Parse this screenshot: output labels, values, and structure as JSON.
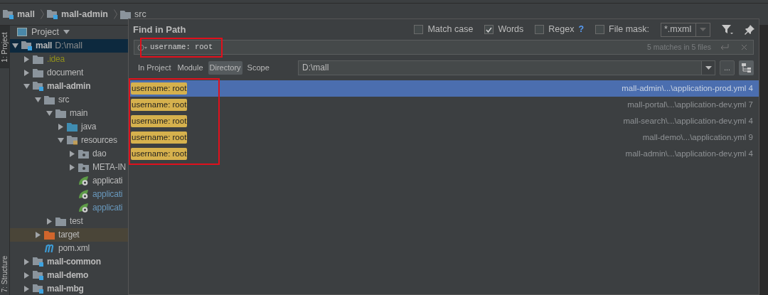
{
  "breadcrumbs": [
    {
      "label": "mall",
      "kind": "module"
    },
    {
      "label": "mall-admin",
      "kind": "module"
    },
    {
      "label": "src",
      "kind": "folder"
    }
  ],
  "tool_stripe": {
    "top": "1: Project",
    "bottom": "7: Structure"
  },
  "project_panel": {
    "title": "Project",
    "tree": [
      {
        "label": "mall",
        "path": "D:\\mall",
        "kind": "module",
        "expanded": true,
        "selected": true,
        "children": [
          {
            "label": ".idea",
            "kind": "folder",
            "expanded": false,
            "selected": false,
            "ignored": true
          },
          {
            "label": "document",
            "kind": "folder",
            "expanded": false,
            "selected": false
          },
          {
            "label": "mall-admin",
            "kind": "module",
            "expanded": true,
            "selected": false,
            "children": [
              {
                "label": "src",
                "kind": "folder",
                "expanded": true,
                "selected": false,
                "children": [
                  {
                    "label": "main",
                    "kind": "folder",
                    "expanded": true,
                    "selected": false,
                    "children": [
                      {
                        "label": "java",
                        "kind": "source",
                        "expanded": false,
                        "selected": false
                      },
                      {
                        "label": "resources",
                        "kind": "resources",
                        "expanded": true,
                        "selected": false,
                        "children": [
                          {
                            "label": "dao",
                            "kind": "package",
                            "expanded": false,
                            "selected": false
                          },
                          {
                            "label": "META-IN",
                            "kind": "package",
                            "expanded": false,
                            "selected": false
                          },
                          {
                            "label": "applicati",
                            "kind": "spring",
                            "selected": false
                          },
                          {
                            "label": "applicati",
                            "kind": "spring",
                            "selected": false,
                            "modified": true
                          },
                          {
                            "label": "applicati",
                            "kind": "spring",
                            "selected": false,
                            "modified": true
                          }
                        ]
                      }
                    ]
                  },
                  {
                    "label": "test",
                    "kind": "folder",
                    "expanded": false,
                    "selected": false
                  }
                ]
              },
              {
                "label": "target",
                "kind": "target",
                "expanded": false,
                "selected": false,
                "excluded": true
              },
              {
                "label": "pom.xml",
                "kind": "maven",
                "selected": false
              }
            ]
          },
          {
            "label": "mall-common",
            "kind": "module",
            "expanded": false,
            "selected": false
          },
          {
            "label": "mall-demo",
            "kind": "module",
            "expanded": false,
            "selected": false
          },
          {
            "label": "mall-mbg",
            "kind": "module",
            "expanded": false,
            "selected": false
          }
        ]
      }
    ]
  },
  "dialog": {
    "title": "Find in Path",
    "options": [
      {
        "label": "Match case",
        "checked": false
      },
      {
        "label": "Words",
        "checked": true
      },
      {
        "label": "Regex",
        "checked": false,
        "help": "?"
      },
      {
        "label": "File mask:",
        "checked": false
      }
    ],
    "file_mask": "*.mxml",
    "search": {
      "value": "username: root",
      "summary": "5 matches in 5 files"
    },
    "scopes": [
      {
        "label": "In Project",
        "selected": false
      },
      {
        "label": "Module",
        "selected": false
      },
      {
        "label": "Directory",
        "selected": true
      },
      {
        "label": "Scope",
        "selected": false
      }
    ],
    "directory": "D:\\mall",
    "browse_button": "...",
    "results": [
      {
        "match": "username: root",
        "file": "mall-admin\\...\\application-prod.yml 4",
        "selected": true
      },
      {
        "match": "username: root",
        "file": "mall-portal\\...\\application-dev.yml 7",
        "selected": false
      },
      {
        "match": "username: root",
        "file": "mall-search\\...\\application-dev.yml 4",
        "selected": false
      },
      {
        "match": "username: root",
        "file": "mall-demo\\...\\application.yml 9",
        "selected": false
      },
      {
        "match": "username: root",
        "file": "mall-admin\\...\\application-dev.yml 4",
        "selected": false
      }
    ]
  }
}
